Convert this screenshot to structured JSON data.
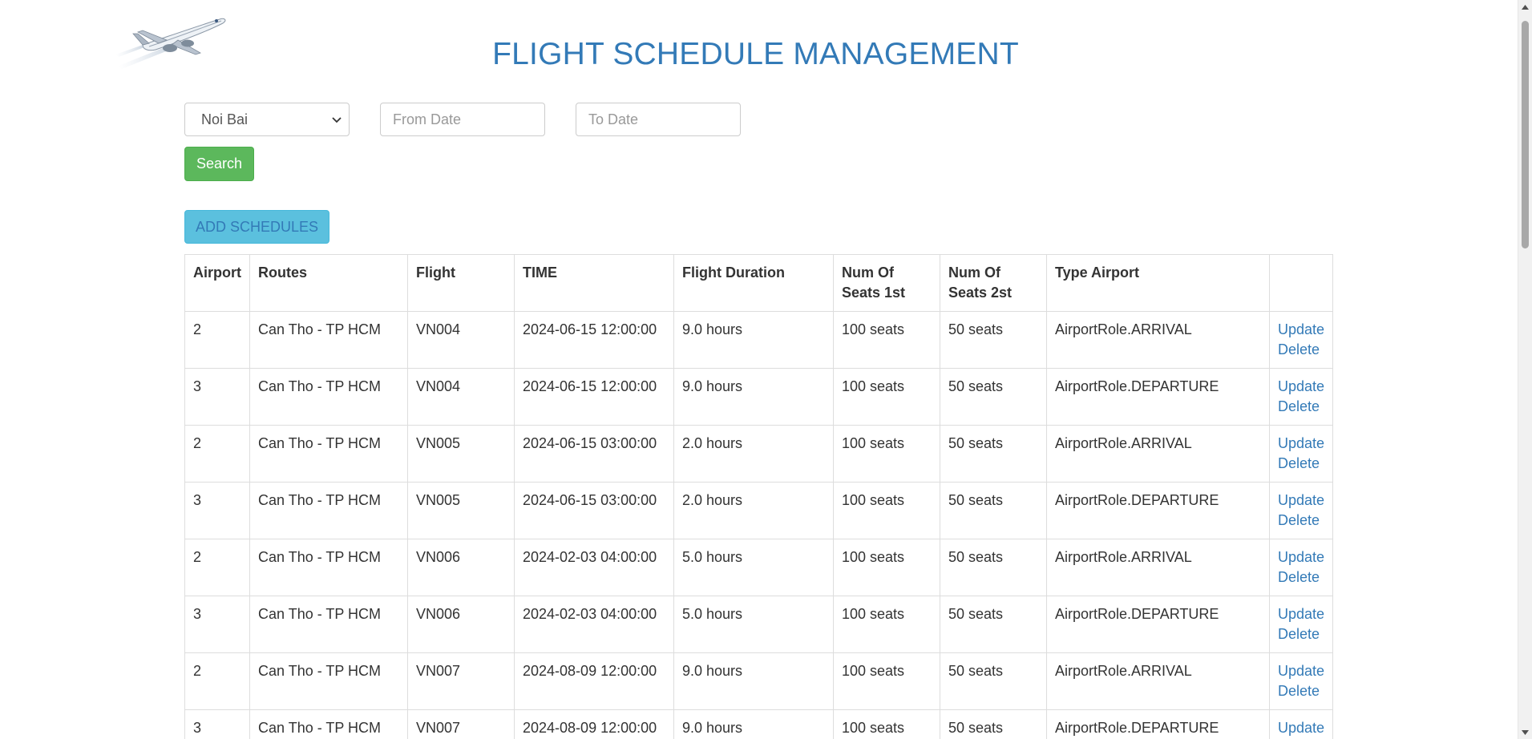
{
  "header": {
    "title": "FLIGHT SCHEDULE MANAGEMENT"
  },
  "search": {
    "airport_selected": "Noi Bai",
    "from_date_placeholder": "From Date",
    "to_date_placeholder": "To Date",
    "search_label": "Search"
  },
  "actions": {
    "add_label": "ADD SCHEDULES"
  },
  "table": {
    "columns": [
      "Airport",
      "Routes",
      "Flight",
      "TIME",
      "Flight Duration",
      "Num Of Seats 1st",
      "Num Of Seats 2st",
      "Type Airport",
      ""
    ],
    "update_label": "Update",
    "delete_label": "Delete",
    "rows": [
      [
        "2",
        "Can Tho - TP HCM",
        "VN004",
        "2024-06-15 12:00:00",
        "9.0 hours",
        "100 seats",
        "50 seats",
        "AirportRole.ARRIVAL"
      ],
      [
        "3",
        "Can Tho - TP HCM",
        "VN004",
        "2024-06-15 12:00:00",
        "9.0 hours",
        "100 seats",
        "50 seats",
        "AirportRole.DEPARTURE"
      ],
      [
        "2",
        "Can Tho - TP HCM",
        "VN005",
        "2024-06-15 03:00:00",
        "2.0 hours",
        "100 seats",
        "50 seats",
        "AirportRole.ARRIVAL"
      ],
      [
        "3",
        "Can Tho - TP HCM",
        "VN005",
        "2024-06-15 03:00:00",
        "2.0 hours",
        "100 seats",
        "50 seats",
        "AirportRole.DEPARTURE"
      ],
      [
        "2",
        "Can Tho - TP HCM",
        "VN006",
        "2024-02-03 04:00:00",
        "5.0 hours",
        "100 seats",
        "50 seats",
        "AirportRole.ARRIVAL"
      ],
      [
        "3",
        "Can Tho - TP HCM",
        "VN006",
        "2024-02-03 04:00:00",
        "5.0 hours",
        "100 seats",
        "50 seats",
        "AirportRole.DEPARTURE"
      ],
      [
        "2",
        "Can Tho - TP HCM",
        "VN007",
        "2024-08-09 12:00:00",
        "9.0 hours",
        "100 seats",
        "50 seats",
        "AirportRole.ARRIVAL"
      ],
      [
        "3",
        "Can Tho - TP HCM",
        "VN007",
        "2024-08-09 12:00:00",
        "9.0 hours",
        "100 seats",
        "50 seats",
        "AirportRole.DEPARTURE"
      ]
    ]
  },
  "colors": {
    "primary": "#337ab7",
    "success": "#5cb85c",
    "info": "#5bc0de"
  },
  "icons": {
    "logo": "airplane-logo-icon",
    "select_arrow": "chevron-down-icon"
  }
}
